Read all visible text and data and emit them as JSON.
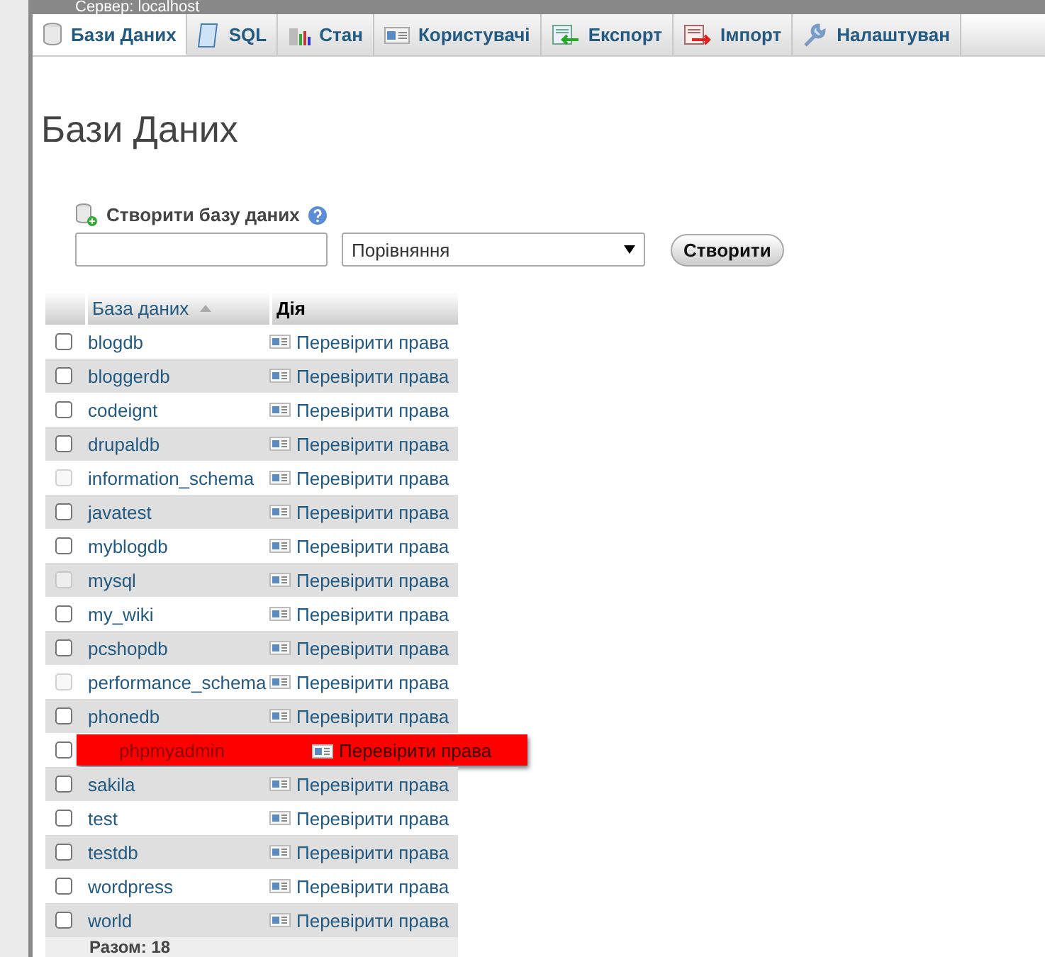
{
  "server": {
    "label": "Сервер: localhost"
  },
  "tabs": [
    {
      "label": "Бази Даних",
      "kind": "db",
      "selected": true
    },
    {
      "label": "SQL",
      "kind": "sql",
      "selected": false
    },
    {
      "label": "Стан",
      "kind": "chart",
      "selected": false
    },
    {
      "label": "Користувачі",
      "kind": "users",
      "selected": false
    },
    {
      "label": "Експорт",
      "kind": "export",
      "selected": false
    },
    {
      "label": "Імпорт",
      "kind": "import",
      "selected": false
    },
    {
      "label": "Налаштуван",
      "kind": "wrench",
      "selected": false
    }
  ],
  "page_title": "Бази Даних",
  "create": {
    "label": "Створити базу даних",
    "collation": "Порівняння",
    "button": "Створити"
  },
  "table": {
    "columns": [
      "База даних",
      "Дія"
    ],
    "rows": [
      {
        "name": "blogdb",
        "action": "Перевірити права",
        "disabled": false,
        "highlighted": false
      },
      {
        "name": "bloggerdb",
        "action": "Перевірити права",
        "disabled": false,
        "highlighted": false
      },
      {
        "name": "codeignt",
        "action": "Перевірити права",
        "disabled": false,
        "highlighted": false
      },
      {
        "name": "drupaldb",
        "action": "Перевірити права",
        "disabled": false,
        "highlighted": false
      },
      {
        "name": "information_schema",
        "action": "Перевірити права",
        "disabled": true,
        "highlighted": false
      },
      {
        "name": "javatest",
        "action": "Перевірити права",
        "disabled": false,
        "highlighted": false
      },
      {
        "name": "myblogdb",
        "action": "Перевірити права",
        "disabled": false,
        "highlighted": false
      },
      {
        "name": "mysql",
        "action": "Перевірити права",
        "disabled": true,
        "highlighted": false
      },
      {
        "name": "my_wiki",
        "action": "Перевірити права",
        "disabled": false,
        "highlighted": false
      },
      {
        "name": "pcshopdb",
        "action": "Перевірити права",
        "disabled": false,
        "highlighted": false
      },
      {
        "name": "performance_schema",
        "action": "Перевірити права",
        "disabled": true,
        "highlighted": false
      },
      {
        "name": "phonedb",
        "action": "Перевірити права",
        "disabled": false,
        "highlighted": false
      },
      {
        "name": "phpmyadmin",
        "action": "Перевірити права",
        "disabled": false,
        "highlighted": true
      },
      {
        "name": "sakila",
        "action": "Перевірити права",
        "disabled": false,
        "highlighted": false
      },
      {
        "name": "test",
        "action": "Перевірити права",
        "disabled": false,
        "highlighted": false
      },
      {
        "name": "testdb",
        "action": "Перевірити права",
        "disabled": false,
        "highlighted": false
      },
      {
        "name": "wordpress",
        "action": "Перевірити права",
        "disabled": false,
        "highlighted": false
      },
      {
        "name": "world",
        "action": "Перевірити права",
        "disabled": false,
        "highlighted": false
      }
    ],
    "total": "Разом: 18"
  }
}
